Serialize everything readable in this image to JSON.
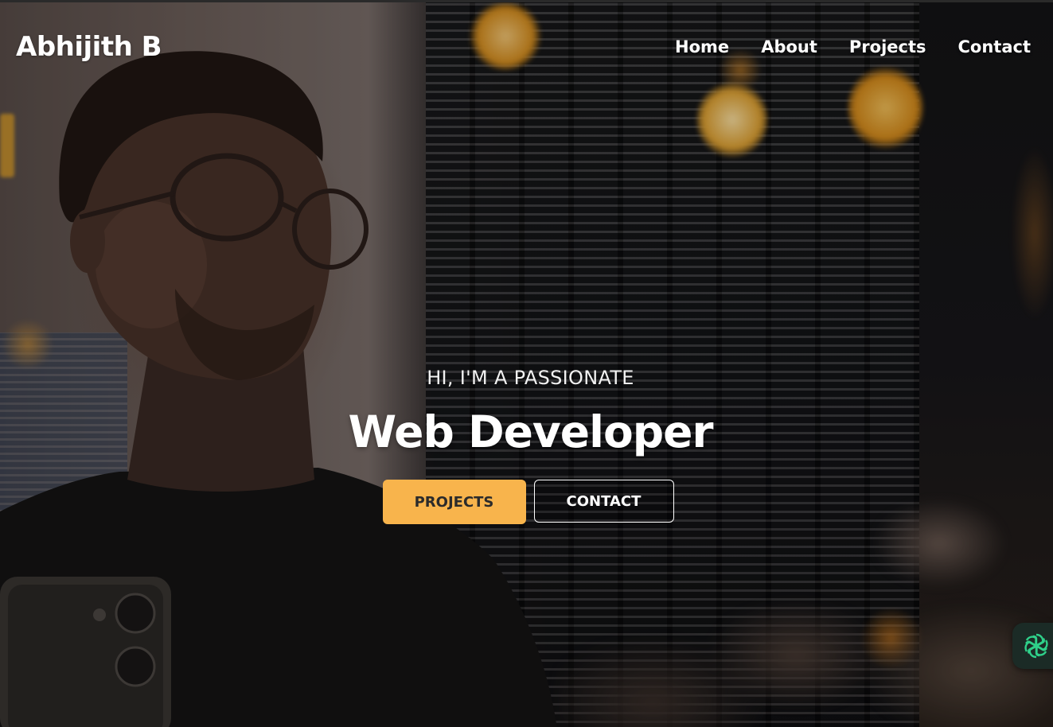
{
  "header": {
    "logo": "Abhijith B",
    "nav": [
      {
        "label": "Home"
      },
      {
        "label": "About"
      },
      {
        "label": "Projects"
      },
      {
        "label": "Contact"
      }
    ]
  },
  "hero": {
    "subtitle": "HI, I'M A PASSIONATE",
    "title": "Web Developer",
    "primary_button": "PROJECTS",
    "secondary_button": "CONTACT"
  },
  "widget": {
    "icon": "openai-logo-icon"
  },
  "colors": {
    "accent": "#f8b44c",
    "text": "#ffffff",
    "widget_bg": "#1b2b26",
    "widget_icon": "#2fd08a"
  }
}
